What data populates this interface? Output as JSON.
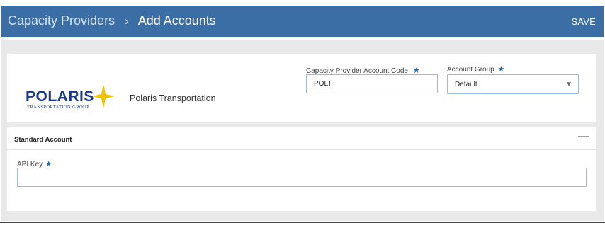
{
  "header": {
    "breadcrumb_parent": "Capacity Providers",
    "breadcrumb_separator": "›",
    "breadcrumb_current": "Add Accounts",
    "save_label": "SAVE",
    "background": "#3a6ea5"
  },
  "provider": {
    "logo_text": "POLARIS",
    "logo_subtitle": "TRANSPORTATION GROUP",
    "name": "Polaris Transportation"
  },
  "fields": {
    "account_code": {
      "label": "Capacity Provider Account Code",
      "required_mark": "★",
      "value": "POLT"
    },
    "account_group": {
      "label": "Account Group",
      "required_mark": "★",
      "value": "Default",
      "arrow": "▼"
    },
    "api_key": {
      "label": "API Key",
      "required_mark": "★",
      "value": ""
    }
  },
  "section": {
    "title": "Standard Account",
    "collapse_symbol": "—"
  },
  "colors": {
    "accent": "#2b65b0",
    "logo_blue": "#1b3a8a",
    "logo_star": "#f2c200"
  }
}
